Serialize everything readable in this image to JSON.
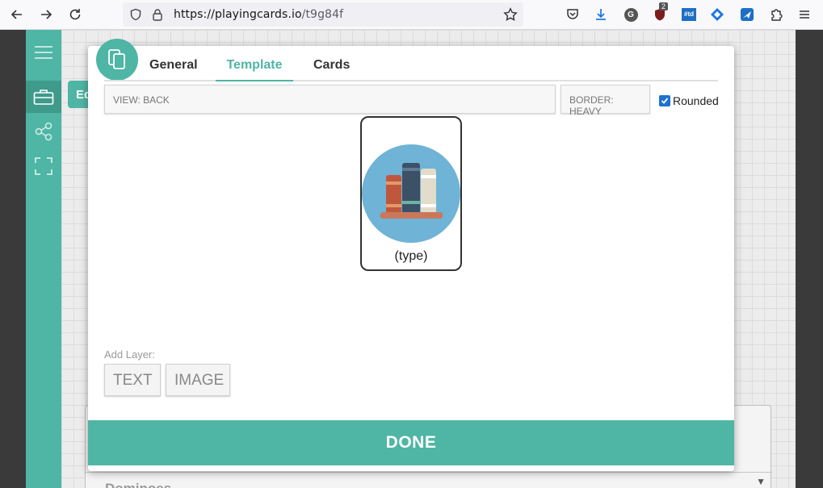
{
  "browser": {
    "url_host": "https://playingcards.io",
    "url_path": "/t9g84f",
    "extension_badge_count": "2",
    "td_extension_label": "#td",
    "g_extension_label": "G"
  },
  "sidebar": {
    "items": [
      {
        "icon": "hamburger-menu-icon"
      },
      {
        "icon": "briefcase-icon"
      },
      {
        "icon": "share-icon"
      },
      {
        "icon": "fullscreen-icon"
      }
    ]
  },
  "background": {
    "edit_tab_label": "Ed",
    "select_label": "Dominoes"
  },
  "modal": {
    "tabs": [
      {
        "label": "General"
      },
      {
        "label": "Template",
        "active": true
      },
      {
        "label": "Cards"
      }
    ],
    "view_field": "VIEW: BACK",
    "border_field": "BORDER: HEAVY",
    "rounded_label": "Rounded",
    "rounded_checked": true,
    "card_type_text": "(type)",
    "add_layer_label": "Add Layer:",
    "text_button": "TEXT",
    "image_button": "IMAGE",
    "done_button": "DONE"
  },
  "colors": {
    "accent": "#4fb5a4",
    "checkbox": "#1e73d2"
  }
}
